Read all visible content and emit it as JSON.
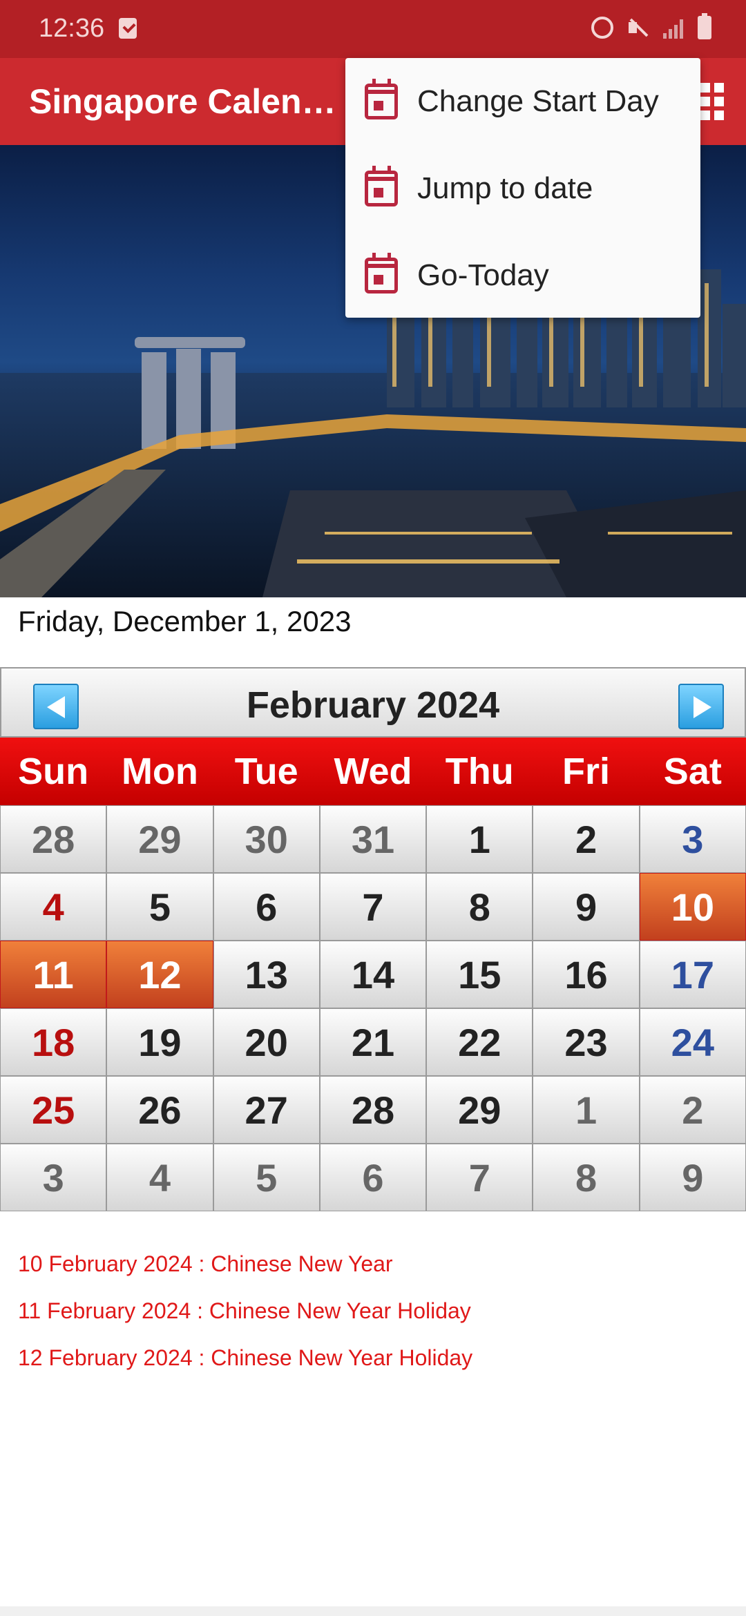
{
  "status_bar": {
    "time": "12:36"
  },
  "app_bar": {
    "title": "Singapore Calen…"
  },
  "menu": {
    "items": [
      {
        "label": "Change Start Day",
        "icon": "calendar-icon"
      },
      {
        "label": "Jump to date",
        "icon": "calendar-icon"
      },
      {
        "label": "Go-Today",
        "icon": "calendar-icon"
      }
    ]
  },
  "today_line": "Friday, December 1, 2023",
  "calendar": {
    "month_title": "February  2024",
    "weekdays": [
      "Sun",
      "Mon",
      "Tue",
      "Wed",
      "Thu",
      "Fri",
      "Sat"
    ],
    "weeks": [
      [
        "28",
        "29",
        "30",
        "31",
        "1",
        "2",
        "3"
      ],
      [
        "4",
        "5",
        "6",
        "7",
        "8",
        "9",
        "10"
      ],
      [
        "11",
        "12",
        "13",
        "14",
        "15",
        "16",
        "17"
      ],
      [
        "18",
        "19",
        "20",
        "21",
        "22",
        "23",
        "24"
      ],
      [
        "25",
        "26",
        "27",
        "28",
        "29",
        "1",
        "2"
      ],
      [
        "3",
        "4",
        "5",
        "6",
        "7",
        "8",
        "9"
      ]
    ]
  },
  "holidays": [
    "10 February 2024 : Chinese New Year",
    "11 February 2024 : Chinese New Year Holiday",
    "12 February 2024 : Chinese New Year Holiday"
  ],
  "colors": {
    "app_bar": "#cc2a2f",
    "status_bar": "#b32025",
    "weekday_header": "#e00808",
    "holiday_cell": "#d8552a",
    "sunday_text": "#b80f0f",
    "saturday_text": "#2e4f9e",
    "holiday_text": "#e01818"
  }
}
